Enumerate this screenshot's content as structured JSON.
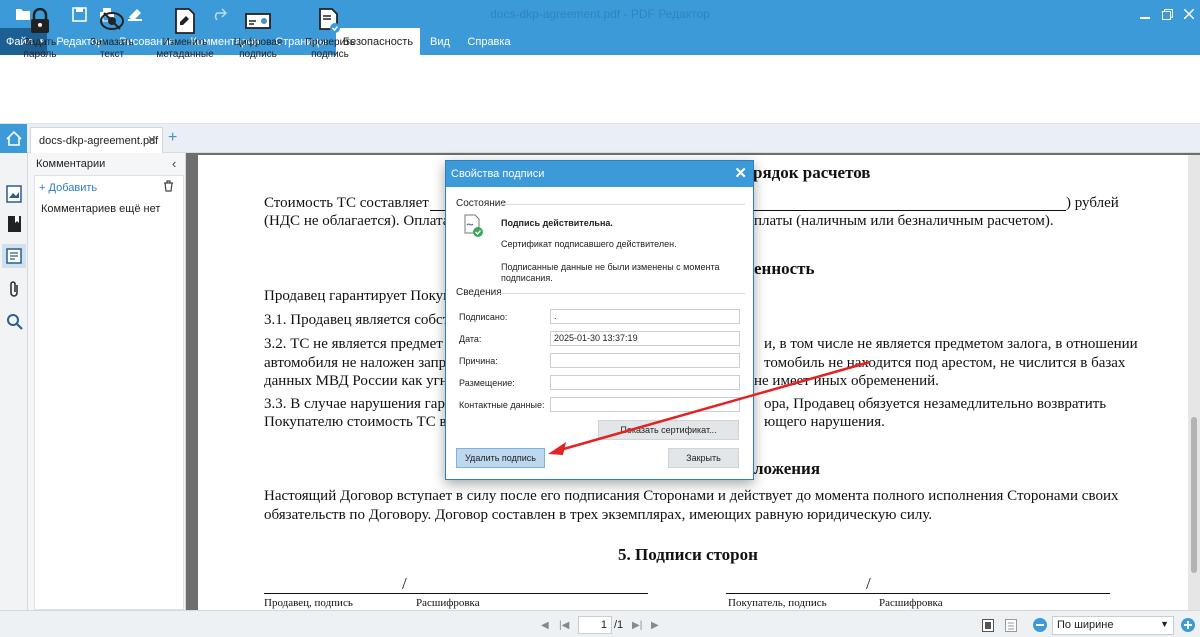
{
  "app": {
    "title": "docs-dkp-agreement.pdf - PDF Редактор"
  },
  "menu": {
    "file": "Файл",
    "tabs": [
      "Редактор",
      "Рисование",
      "Комментарии",
      "Страницы",
      "Безопасность",
      "Вид",
      "Справка"
    ],
    "active_tab": "Безопасность"
  },
  "ribbon": {
    "set_password": "Задать пароль",
    "redact": "Замазать текст",
    "metadata": "Изменить метаданные",
    "digital_sig": "Цифровая подпись",
    "verify": "Проверить подпись"
  },
  "doc_tab": {
    "name": "docs-dkp-agreement.pdf"
  },
  "panel": {
    "title": "Комментарии",
    "add": "Добавить",
    "empty": "Комментариев ещё нет"
  },
  "page": {
    "heading_top": "рядок расчетов",
    "p1": "Стоимость ТС составляет",
    "p1_tail": ") рублей",
    "p1_l2a": "(НДС не облагается). Оплата",
    "p1_l2b": "платы (наличным или безналичным расчетом).",
    "heading2": "енность",
    "p2": "Продавец гарантирует Покуп",
    "p3": "3.1. Продавец является собст",
    "p4a": "3.2. ТС не является предмет",
    "p4b": "и, в том числе не является предметом залога, в отношении",
    "p5a": "автомобиля не наложен запр",
    "p5b": "томобиль не находится под арестом, не числится в базах",
    "p6a": "данных МВД России как угн",
    "p6b": "не имеет иных обременений.",
    "p7a": "3.3. В случае нарушения гара",
    "p7b": "ора, Продавец обязуется незамедлительно возвратить",
    "p8a": "Покупателю стоимость ТС в",
    "p8b": "ющего нарушения.",
    "heading3": "ложения",
    "p9": "Настоящий Договор вступает в силу после его подписания Сторонами и действует до момента полного исполнения Сторонами своих",
    "p10": "обязательств по Договору. Договор составлен в трех экземплярах, имеющих равную юридическую силу.",
    "heading4": "5. Подписи сторон",
    "seller": "Продавец, подпись",
    "seller_decode": "Расшифровка",
    "buyer": "Покупатель, подпись",
    "buyer_decode": "Расшифровка"
  },
  "dialog": {
    "title": "Свойства подписи",
    "state_label": "Состояние",
    "valid": "Подпись действительна.",
    "cert_valid": "Сертификат подписавшего действителен.",
    "unchanged": "Подписанные данные не были изменены с момента подписания.",
    "info_label": "Сведения",
    "fields": [
      {
        "label": "Подписано:",
        "value": "."
      },
      {
        "label": "Дата:",
        "value": "2025-01-30 13:37:19"
      },
      {
        "label": "Причина:",
        "value": ""
      },
      {
        "label": "Размещение:",
        "value": ""
      },
      {
        "label": "Контактные данные:",
        "value": ""
      }
    ],
    "show_cert": "Показать сертификат...",
    "remove_sig": "Удалить подпись",
    "close": "Закрыть"
  },
  "status": {
    "page_current": "1",
    "page_total": "/1",
    "zoom": "По ширине"
  }
}
